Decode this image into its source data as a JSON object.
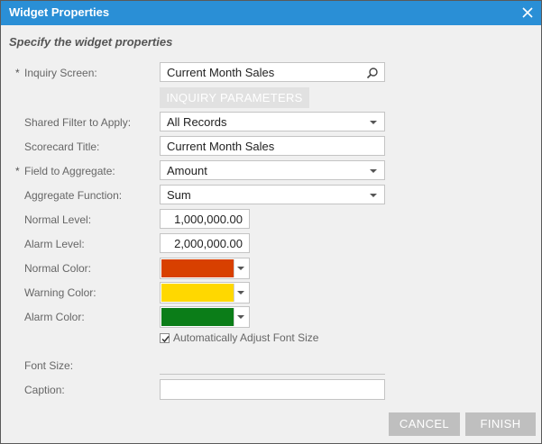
{
  "dialog": {
    "title": "Widget Properties",
    "subtitle": "Specify the widget properties"
  },
  "form": {
    "inquiry_screen": {
      "label": "Inquiry Screen:",
      "required": "*",
      "value": "Current Month Sales"
    },
    "inquiry_parameters_button": "INQUIRY PARAMETERS",
    "shared_filter": {
      "label": "Shared Filter to Apply:",
      "value": "All Records"
    },
    "scorecard_title": {
      "label": "Scorecard Title:",
      "value": "Current Month Sales"
    },
    "field_to_aggregate": {
      "label": "Field to Aggregate:",
      "required": "*",
      "value": "Amount"
    },
    "aggregate_function": {
      "label": "Aggregate Function:",
      "value": "Sum"
    },
    "normal_level": {
      "label": "Normal Level:",
      "value": "1,000,000.00"
    },
    "alarm_level": {
      "label": "Alarm Level:",
      "value": "2,000,000.00"
    },
    "normal_color": {
      "label": "Normal Color:",
      "color": "#d84000"
    },
    "warning_color": {
      "label": "Warning Color:",
      "color": "#ffd800"
    },
    "alarm_color": {
      "label": "Alarm Color:",
      "color": "#0b7d18"
    },
    "auto_font": {
      "label": "Automatically Adjust Font Size",
      "checked": true
    },
    "font_size": {
      "label": "Font Size:"
    },
    "caption": {
      "label": "Caption:",
      "value": ""
    }
  },
  "buttons": {
    "cancel": "CANCEL",
    "finish": "FINISH"
  },
  "colors": {
    "titlebar": "#2a8fd6",
    "dialog_bg": "#f0f0f0",
    "button_bg": "#bfbfbf"
  },
  "icons": {
    "close": "close-icon",
    "search": "search-icon",
    "dropdown": "chevron-down-icon",
    "check": "check-icon"
  }
}
